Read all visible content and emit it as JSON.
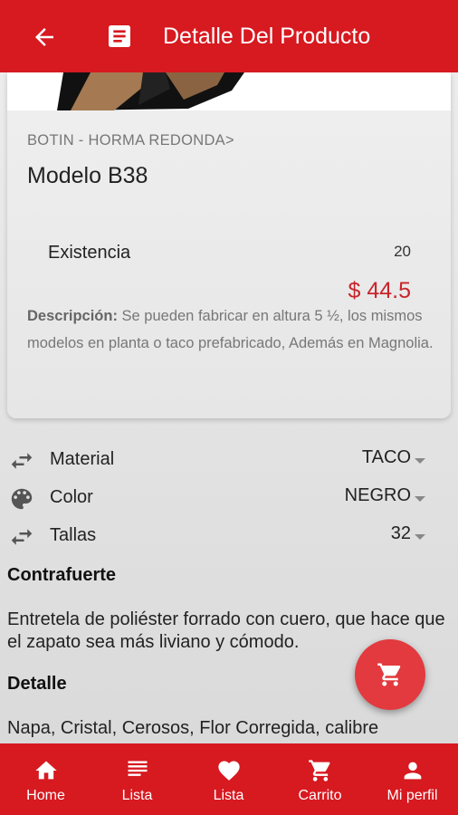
{
  "appbar": {
    "title": "Detalle Del Producto"
  },
  "product": {
    "category": "BOTIN - HORMA REDONDA>",
    "model": "Modelo B38",
    "stock_label": "Existencia",
    "stock_value": "20",
    "price": "$ 44.5",
    "description_label": "Descripción:",
    "description_text": " Se pueden fabricar en altura 5 ½, los mismos modelos en planta o taco prefabricado, Además en Magnolia."
  },
  "options": [
    {
      "icon": "swap-arrows-icon",
      "label": "Material",
      "value": "TACO"
    },
    {
      "icon": "palette-icon",
      "label": "Color",
      "value": "NEGRO"
    },
    {
      "icon": "swap-arrows-icon",
      "label": "Tallas",
      "value": "32"
    }
  ],
  "sections": [
    {
      "title": "Contrafuerte",
      "text": "Entretela de poliéster forrado con cuero, que hace que el zapato sea más liviano y cómodo."
    },
    {
      "title": "Detalle",
      "text": "Napa, Cristal, Cerosos, Flor Corregida, calibre"
    }
  ],
  "nav": [
    {
      "icon": "home-icon",
      "label": "Home"
    },
    {
      "icon": "list-icon",
      "label": "Lista"
    },
    {
      "icon": "heart-icon",
      "label": "Lista"
    },
    {
      "icon": "cart-icon",
      "label": "Carrito"
    },
    {
      "icon": "person-icon",
      "label": "Mi perfil"
    }
  ],
  "colors": {
    "primary": "#d71920",
    "price": "#c9242b",
    "fab": "#e23a3f"
  }
}
